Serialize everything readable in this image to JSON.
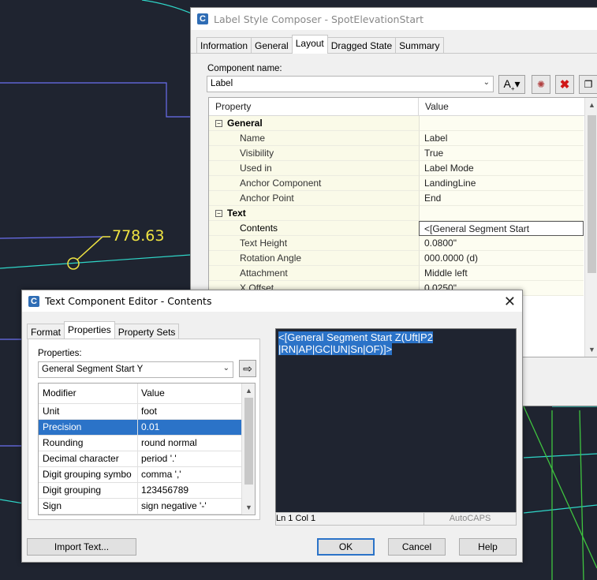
{
  "drawing": {
    "elevation_label": "778.63"
  },
  "label_style_composer": {
    "title": "Label Style Composer - SpotElevationStart",
    "tabs": [
      "Information",
      "General",
      "Layout",
      "Dragged State",
      "Summary"
    ],
    "selected_tab": "Layout",
    "component_name_label": "Component name:",
    "component_name_value": "Label",
    "columns": {
      "property": "Property",
      "value": "Value"
    },
    "categories": [
      {
        "name": "General",
        "rows": [
          {
            "property": "Name",
            "value": "Label"
          },
          {
            "property": "Visibility",
            "value": "True"
          },
          {
            "property": "Used in",
            "value": "Label Mode"
          },
          {
            "property": "Anchor Component",
            "value": "LandingLine"
          },
          {
            "property": "Anchor Point",
            "value": "End"
          }
        ]
      },
      {
        "name": "Text",
        "rows": [
          {
            "property": "Contents",
            "value": "<[General Segment Start Z(Uft|P2|R..."
          },
          {
            "property": "Text Height",
            "value": "0.0800\""
          },
          {
            "property": "Rotation Angle",
            "value": "000.0000 (d)"
          },
          {
            "property": "Attachment",
            "value": "Middle left"
          },
          {
            "property": "X Offset",
            "value": "0.0250\""
          }
        ]
      }
    ]
  },
  "text_component_editor": {
    "title": "Text Component Editor - Contents",
    "tabs": [
      "Format",
      "Properties",
      "Property Sets"
    ],
    "selected_tab": "Properties",
    "properties_label": "Properties:",
    "properties_value": "General Segment Start Y",
    "columns": {
      "modifier": "Modifier",
      "value": "Value"
    },
    "modifiers": [
      {
        "modifier": "Unit",
        "value": "foot"
      },
      {
        "modifier": "Precision",
        "value": "0.01"
      },
      {
        "modifier": "Rounding",
        "value": "round normal"
      },
      {
        "modifier": "Decimal character",
        "value": "period '.'"
      },
      {
        "modifier": "Digit grouping symbo",
        "value": "comma ','"
      },
      {
        "modifier": "Digit grouping",
        "value": "123456789"
      },
      {
        "modifier": "Sign",
        "value": "sign negative '-'"
      }
    ],
    "editor_line1": "<[General Segment Start Z(Uft|P2",
    "editor_line2": "|RN|AP|GC|UN|Sn|OF)]>",
    "status_position": "Ln 1 Col 1",
    "status_caps": "AutoCAPS",
    "buttons": {
      "import": "Import Text...",
      "ok": "OK",
      "cancel": "Cancel",
      "help": "Help"
    }
  },
  "colors": {
    "background": "#1f2430",
    "elevation_text": "#f0e442",
    "selection": "#2b73c8"
  }
}
